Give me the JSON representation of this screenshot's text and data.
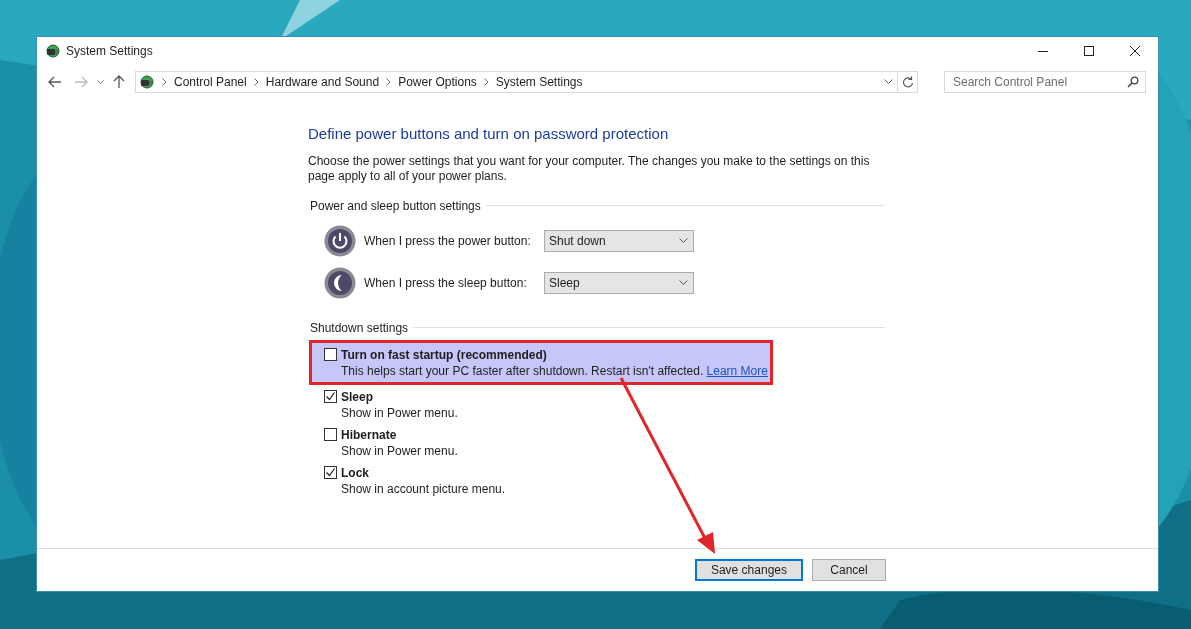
{
  "window": {
    "title": "System Settings"
  },
  "breadcrumb": [
    "Control Panel",
    "Hardware and Sound",
    "Power Options",
    "System Settings"
  ],
  "search": {
    "placeholder": "Search Control Panel"
  },
  "heading": "Define power buttons and turn on password protection",
  "description": "Choose the power settings that you want for your computer. The changes you make to the settings on this page apply to all of your power plans.",
  "power_section": {
    "title": "Power and sleep button settings",
    "rows": [
      {
        "kind": "power",
        "label": "When I press the power button:",
        "value": "Shut down"
      },
      {
        "kind": "sleep",
        "label": "When I press the sleep button:",
        "value": "Sleep"
      }
    ]
  },
  "shutdown_section": {
    "title": "Shutdown settings",
    "options": [
      {
        "label": "Turn on fast startup (recommended)",
        "description": "This helps start your PC faster after shutdown. Restart isn't affected.",
        "link": "Learn More",
        "checked": false,
        "highlighted": true
      },
      {
        "label": "Sleep",
        "description": "Show in Power menu.",
        "checked": true,
        "highlighted": false
      },
      {
        "label": "Hibernate",
        "description": "Show in Power menu.",
        "checked": false,
        "highlighted": false
      },
      {
        "label": "Lock",
        "description": "Show in account picture menu.",
        "checked": true,
        "highlighted": false
      }
    ]
  },
  "buttons": [
    {
      "label": "Save changes",
      "selected": true
    },
    {
      "label": "Cancel",
      "selected": false
    }
  ]
}
